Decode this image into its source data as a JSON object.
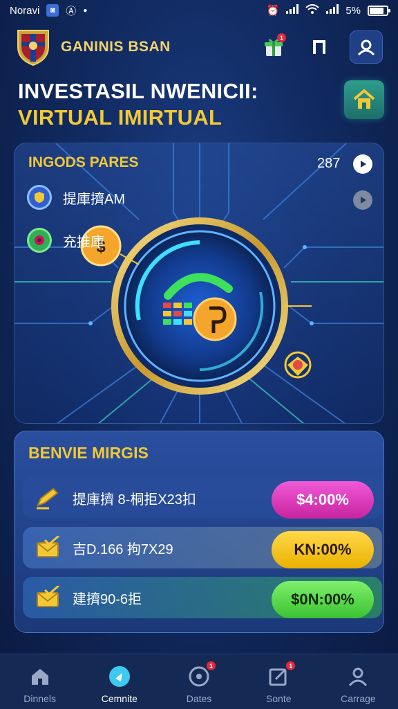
{
  "status_bar": {
    "carrier": "Noravi",
    "battery": "5%",
    "battery_level": 0.82
  },
  "header": {
    "app_name": "GANINIS BSAN",
    "cart_badge": "1"
  },
  "title": {
    "line1": "INVESTASIL NWENICII:",
    "line2": "VIRTUAL IMIRTUAL"
  },
  "featured": {
    "title": "INGODS PARES",
    "count": "287",
    "assets": [
      {
        "label": "提庫擠AM"
      },
      {
        "label": "充推庫"
      }
    ]
  },
  "benefits": {
    "title": "BENVIE MIRGIS",
    "items": [
      {
        "label": "提庫擠 8-桐拒X23扣",
        "value": "$4:00%",
        "color": "#e13fc8"
      },
      {
        "label": "吉D.166 拘7X29",
        "value": "KN:00%",
        "color": "#f6c21c"
      },
      {
        "label": "建擠90-6拒",
        "value": "$0N:00%",
        "color": "#56d646"
      }
    ]
  },
  "nav": {
    "items": [
      {
        "label": "Dinnels"
      },
      {
        "label": "Cemnite"
      },
      {
        "label": "Dates",
        "badge": "1"
      },
      {
        "label": "Sonte",
        "badge": "1"
      },
      {
        "label": "Carrage"
      }
    ]
  },
  "colors": {
    "accent_gold": "#f2c935",
    "bg_dark": "#0a1a40",
    "card_blue": "#2a4f9f"
  }
}
